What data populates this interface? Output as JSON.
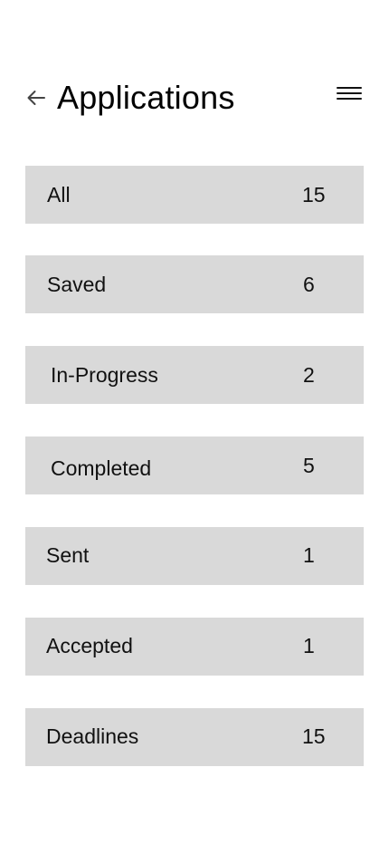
{
  "header": {
    "title": "Applications",
    "back_icon": "arrow-left-icon",
    "menu_icon": "hamburger-menu-icon"
  },
  "categories": [
    {
      "label": "All",
      "count": "15"
    },
    {
      "label": "Saved",
      "count": "6"
    },
    {
      "label": "In-Progress",
      "count": "2"
    },
    {
      "label": "Completed",
      "count": "5"
    },
    {
      "label": "Sent",
      "count": "1"
    },
    {
      "label": "Accepted",
      "count": "1"
    },
    {
      "label": "Deadlines",
      "count": "15"
    }
  ],
  "colors": {
    "row_background": "#d9d9d9",
    "text": "#111111",
    "page_background": "#ffffff"
  }
}
